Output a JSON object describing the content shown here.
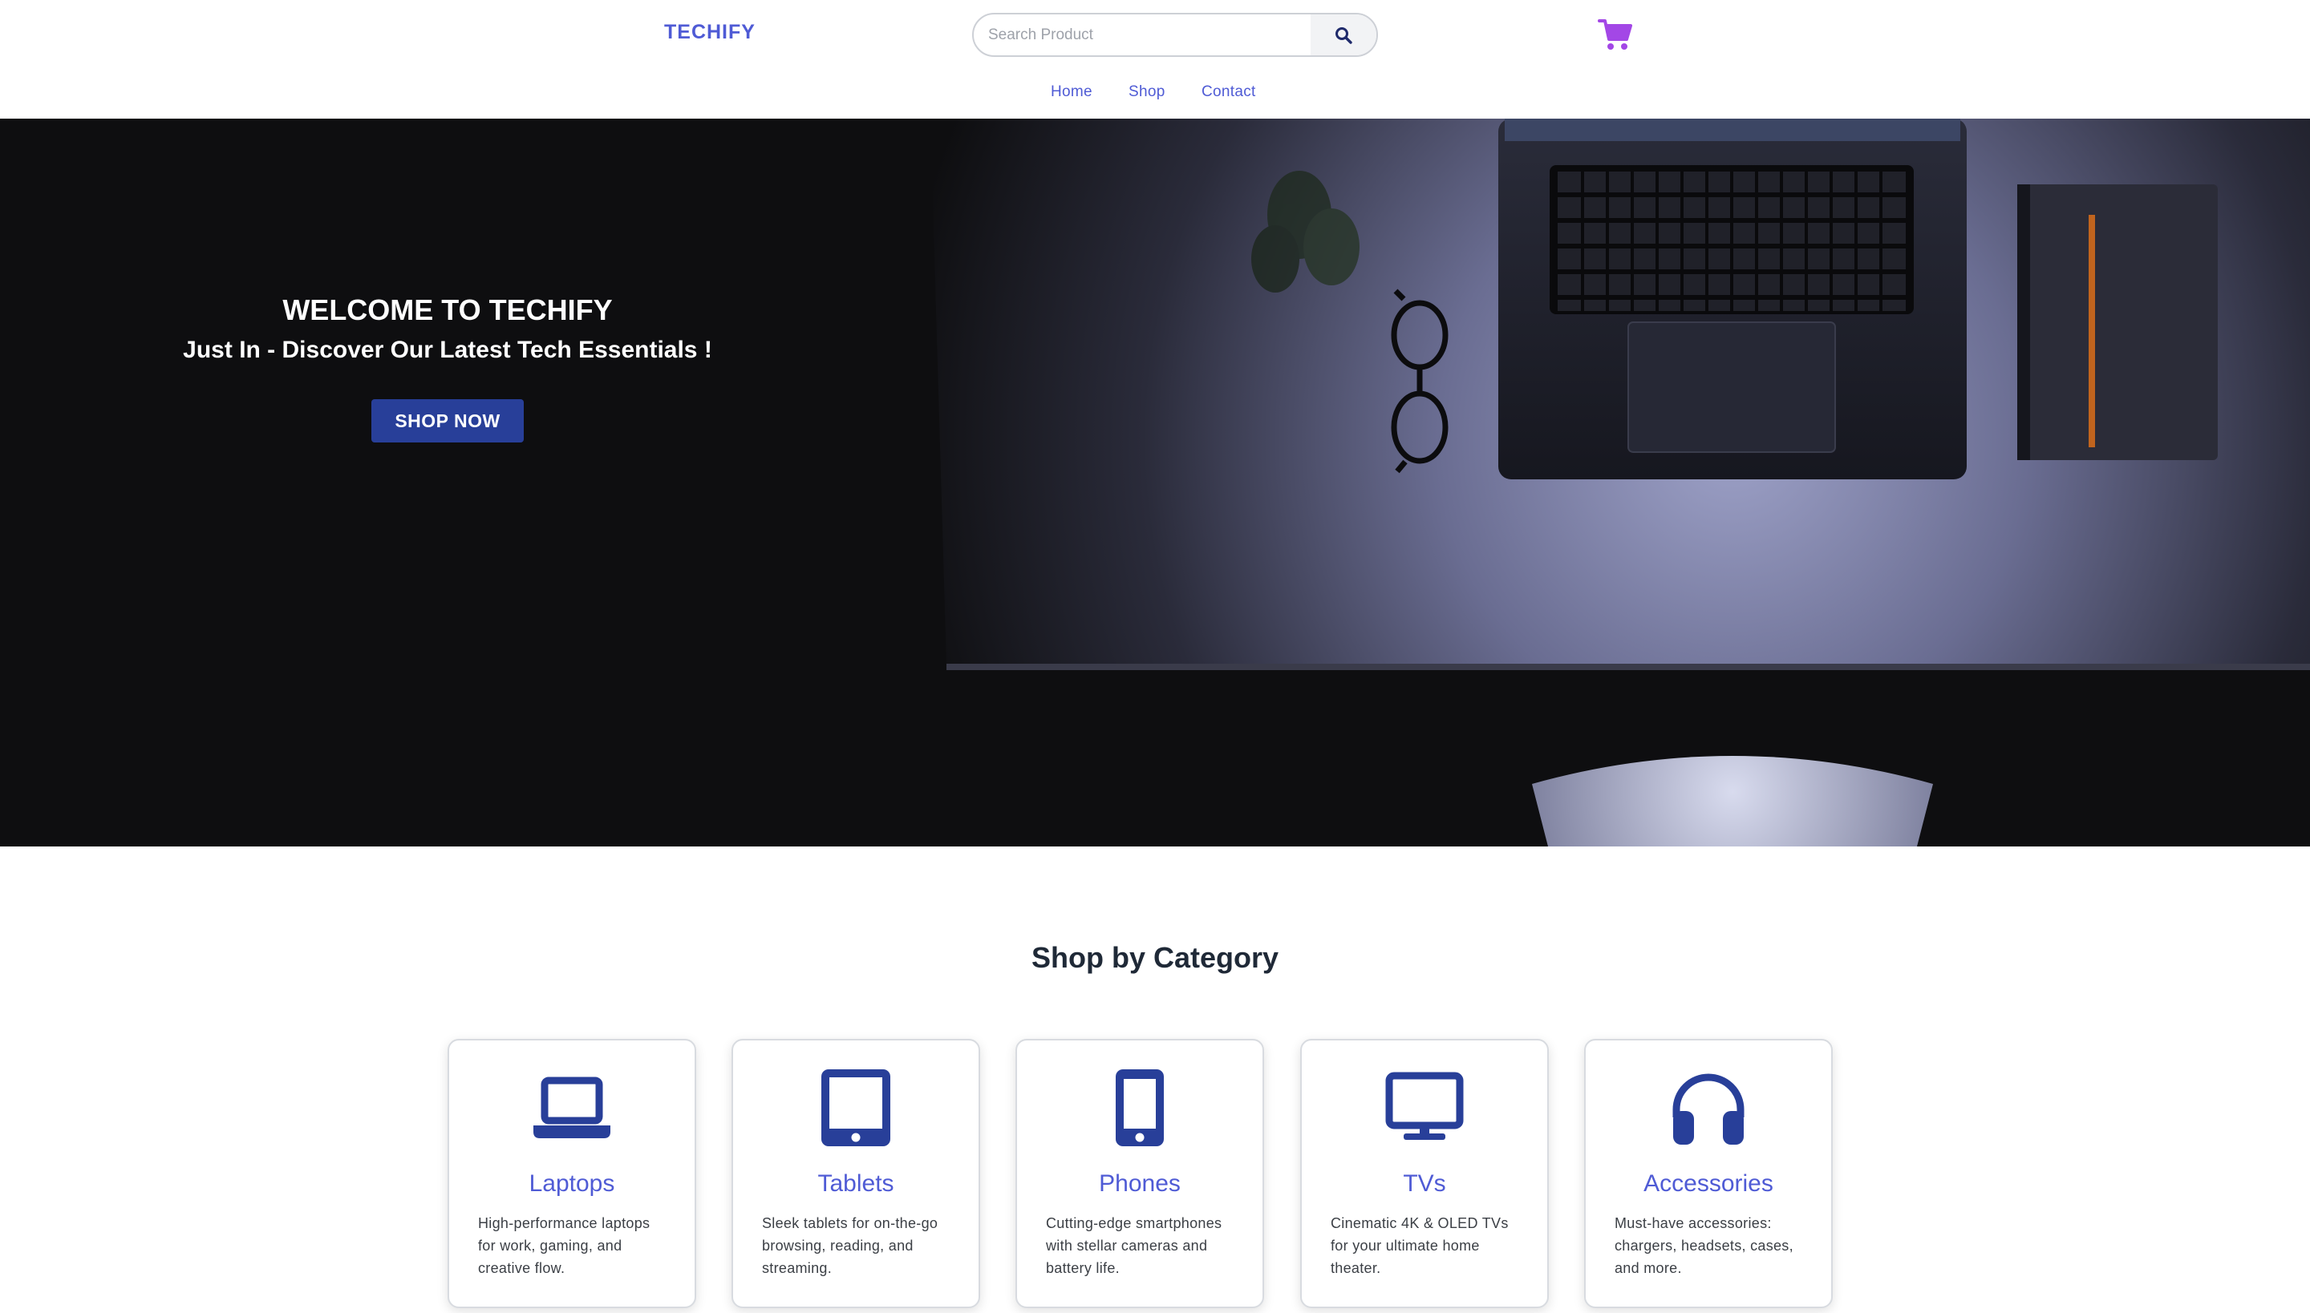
{
  "header": {
    "brand": "TECHIFY",
    "search_placeholder": "Search Product",
    "nav": [
      "Home",
      "Shop",
      "Contact"
    ]
  },
  "hero": {
    "title": "WELCOME TO TECHIFY",
    "subtitle": "Just In - Discover Our Latest Tech Essentials !",
    "button": "SHOP NOW"
  },
  "categories": {
    "title": "Shop by Category",
    "items": [
      {
        "name": "Laptops",
        "desc": "High-performance laptops for work, gaming, and creative flow.",
        "icon": "laptop-icon"
      },
      {
        "name": "Tablets",
        "desc": "Sleek tablets for on-the-go browsing, reading, and streaming.",
        "icon": "tablet-icon"
      },
      {
        "name": "Phones",
        "desc": "Cutting-edge smartphones with stellar cameras and battery life.",
        "icon": "phone-icon"
      },
      {
        "name": "TVs",
        "desc": "Cinematic 4K & OLED TVs for your ultimate home theater.",
        "icon": "tv-icon"
      },
      {
        "name": "Accessories",
        "desc": "Must-have accessories: chargers, headsets, cases, and more.",
        "icon": "headphones-icon"
      }
    ]
  },
  "colors": {
    "brand": "#4f5bd5",
    "button": "#283f99",
    "cart": "#a347e6",
    "icon": "#283f99"
  }
}
